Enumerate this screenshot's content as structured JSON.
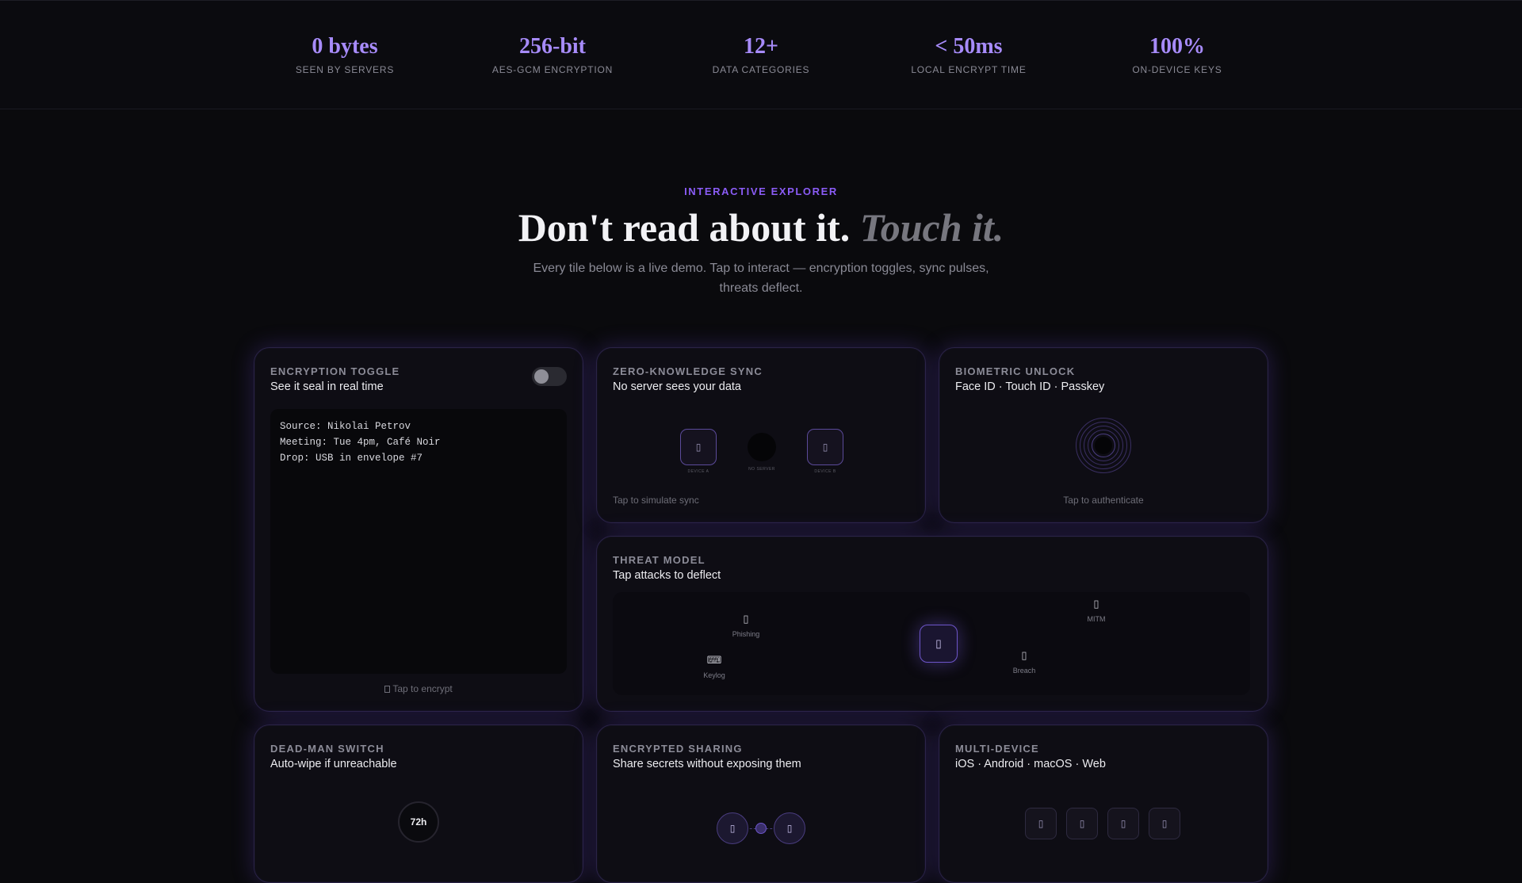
{
  "stats": [
    {
      "value": "0 bytes",
      "label": "SEEN BY SERVERS"
    },
    {
      "value": "256-bit",
      "label": "AES-GCM ENCRYPTION"
    },
    {
      "value": "12+",
      "label": "DATA CATEGORIES"
    },
    {
      "value": "< 50ms",
      "label": "LOCAL ENCRYPT TIME"
    },
    {
      "value": "100%",
      "label": "ON-DEVICE KEYS"
    }
  ],
  "hero": {
    "eyebrow": "INTERACTIVE EXPLORER",
    "headline_plain": "Don't read about it.",
    "headline_accent": "Touch it.",
    "subtitle": "Every tile below is a live demo. Tap to interact — encryption toggles, sync pulses, threats deflect."
  },
  "cards": {
    "encryption": {
      "eyebrow": "ENCRYPTION TOGGLE",
      "title": "See it seal in real time",
      "toggle_on": false,
      "lines": [
        "Source: Nikolai Petrov",
        "Meeting: Tue 4pm, Café Noir",
        "Drop: USB in envelope #7"
      ],
      "hint_icon": "lock-icon",
      "hint": "Tap to encrypt"
    },
    "sync": {
      "eyebrow": "ZERO-KNOWLEDGE SYNC",
      "title": "No server sees your data",
      "device_a": "DEVICE A",
      "relay": "NO SERVER",
      "device_b": "DEVICE B",
      "hint": "Tap to simulate sync"
    },
    "biometric": {
      "eyebrow": "BIOMETRIC UNLOCK",
      "title": "Face ID · Touch ID · Passkey",
      "icon": "fingerprint-icon",
      "hint": "Tap to authenticate"
    },
    "threat": {
      "eyebrow": "THREAT MODEL",
      "title": "Tap attacks to deflect",
      "center_icon": "shield-icon",
      "threats": [
        {
          "label": "Phishing",
          "icon": "fishing-hook-icon"
        },
        {
          "label": "MITM",
          "icon": "incognito-icon"
        },
        {
          "label": "Keylog",
          "icon": "keyboard-icon"
        },
        {
          "label": "Breach",
          "icon": "skull-icon"
        }
      ]
    },
    "deadman": {
      "eyebrow": "DEAD-MAN SWITCH",
      "title": "Auto-wipe if unreachable",
      "timer": "72h"
    },
    "sharing": {
      "eyebrow": "ENCRYPTED SHARING",
      "title": "Share secrets without exposing them"
    },
    "multidevice": {
      "eyebrow": "MULTI-DEVICE",
      "title": "iOS · Android · macOS · Web",
      "devices": [
        "phone-icon",
        "android-icon",
        "laptop-icon",
        "globe-icon"
      ]
    }
  },
  "colors": {
    "accent": "#a78bfa",
    "accent_strong": "#8b5cf6",
    "background": "#0a0a0d",
    "card_border": "#2a2346"
  }
}
